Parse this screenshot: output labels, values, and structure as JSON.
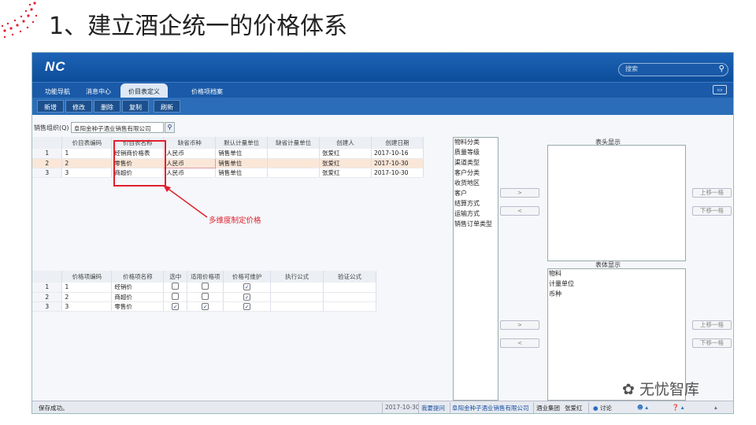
{
  "slide": {
    "title": "1、建立酒企统一的价格体系"
  },
  "app": {
    "logo": "NC",
    "search_placeholder": "搜索",
    "tabs": [
      "功能导航",
      "消息中心",
      "价目表定义",
      "价格项档案"
    ],
    "active_tab": "价目表定义",
    "window_button": "▭",
    "toolbar": [
      "新增",
      "修改",
      "删除",
      "复制",
      "刷新"
    ],
    "org_label": "销售组织(Q)",
    "org_value": "阜阳金种子酒业销售有限公司"
  },
  "price_table": {
    "headers": [
      "",
      "价目表编码",
      "价目表名称",
      "缺省币种",
      "默认计量单位",
      "缺省计量单位",
      "创建人",
      "创建日期"
    ],
    "rows": [
      [
        "1",
        "1",
        "经销商价格表",
        "人民币",
        "销售单位",
        "",
        "张爱红",
        "2017-10-16"
      ],
      [
        "2",
        "2",
        "零售价",
        "人民币",
        "销售单位",
        "",
        "张爱红",
        "2017-10-30"
      ],
      [
        "3",
        "3",
        "商超价",
        "人民币",
        "销售单位",
        "",
        "张爱红",
        "2017-10-30"
      ]
    ]
  },
  "annotation": "多维度制定价格",
  "price_items": {
    "headers": [
      "",
      "价格项编码",
      "价格项名称",
      "选中",
      "适用价格项",
      "价格可维护",
      "执行公式",
      "验证公式"
    ],
    "rows": [
      {
        "n": "1",
        "code": "1",
        "name": "经销价",
        "selected": false,
        "applicable": false,
        "maintainable": true
      },
      {
        "n": "2",
        "code": "2",
        "name": "商超价",
        "selected": false,
        "applicable": false,
        "maintainable": true
      },
      {
        "n": "3",
        "code": "3",
        "name": "零售价",
        "selected": true,
        "applicable": true,
        "maintainable": true
      }
    ]
  },
  "dimensions": [
    "物料分类",
    "质量等级",
    "渠道类型",
    "客户分类",
    "收货地区",
    "客户",
    "结算方式",
    "运输方式",
    "销售订单类型"
  ],
  "header_display": {
    "label": "表头显示",
    "items": []
  },
  "body_display": {
    "label": "表体显示",
    "items": [
      "物料",
      "计量单位",
      "币种"
    ]
  },
  "move_buttons": {
    "add": ">",
    "remove": "<",
    "up": "上移一格",
    "down": "下移一格"
  },
  "status": {
    "message": "保存成功。",
    "date": "2017-10-30",
    "quick": "我要提问",
    "org": "阜阳金种子酒业销售有限公司",
    "group": "酒业集团",
    "user": "张爱红",
    "discuss": "讨论"
  },
  "watermark": "无忧智库"
}
